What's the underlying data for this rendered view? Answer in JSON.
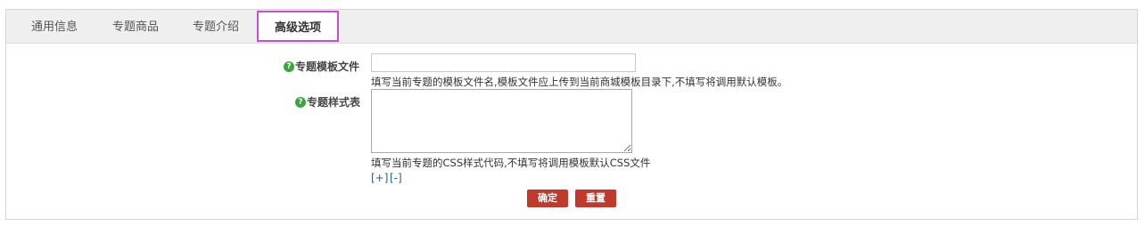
{
  "tabs": [
    {
      "label": "通用信息"
    },
    {
      "label": "专题商品"
    },
    {
      "label": "专题介绍"
    },
    {
      "label": "高级选项"
    }
  ],
  "active_tab": "高级选项",
  "form": {
    "template_file": {
      "help_icon": "?",
      "label": "专题模板文件",
      "value": "",
      "hint": "填写当前专题的模板文件名,模板文件应上传到当前商城模板目录下,不填写将调用默认模板。"
    },
    "stylesheet": {
      "help_icon": "?",
      "label": "专题样式表",
      "value": "",
      "hint": "填写当前专题的CSS样式代码,不填写将调用模板默认CSS文件",
      "expand": "[+]",
      "shrink": "[-]"
    }
  },
  "buttons": {
    "confirm": "确定",
    "reset": "重置"
  },
  "colors": {
    "active_tab_border": "#c94ddb",
    "button_bg": "#c0392b",
    "help_icon": "#3aa53a",
    "link": "#1f5f9e"
  }
}
